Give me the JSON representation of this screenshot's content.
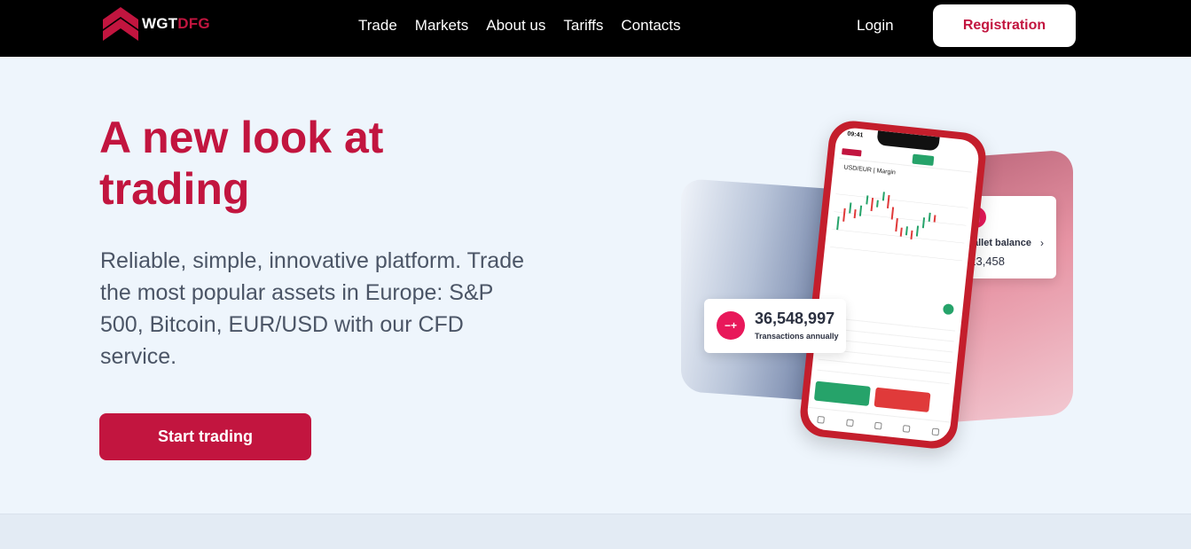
{
  "brand": {
    "part1": "WGT",
    "part2": "DFG"
  },
  "nav": {
    "items": [
      "Trade",
      "Markets",
      "About us",
      "Tariffs",
      "Contacts"
    ],
    "login": "Login",
    "register": "Registration"
  },
  "hero": {
    "title": "A new look at trading",
    "description": "Reliable, simple, innovative platform. Trade the most popular assets in Europe: S&P 500, Bitcoin, EUR/USD with our CFD service.",
    "cta": "Start trading"
  },
  "illustration": {
    "wallet": {
      "label": "Wallet balance",
      "value": "$23,458"
    },
    "transactions": {
      "value": "36,548,997",
      "label": "Transactions annually"
    },
    "phone": {
      "time": "09:41",
      "pair": "USD/EUR | Margin"
    }
  },
  "colors": {
    "brand": "#c2153f",
    "header_bg": "#000000",
    "page_bg": "#eef5fc",
    "accent_pink": "#e8185a"
  },
  "icons": [
    "logo-chevrons-icon",
    "wallet-icon",
    "transactions-icon",
    "chevron-right-icon"
  ]
}
